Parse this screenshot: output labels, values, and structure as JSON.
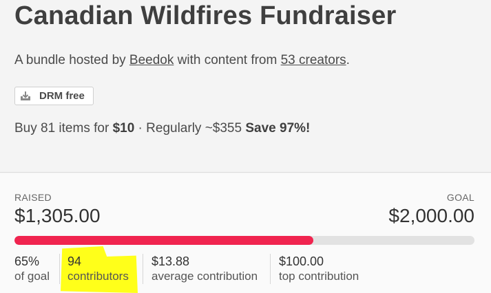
{
  "header": {
    "title": "Canadian Wildfires Fundraiser",
    "byline_prefix": "A bundle hosted by",
    "host_name": "Beedok",
    "byline_mid": "with content from",
    "creators_link": "53 creators",
    "byline_suffix": "."
  },
  "badge": {
    "label": "DRM free",
    "icon": "download-tray-icon"
  },
  "pricing": {
    "prefix": "Buy 81 items for",
    "price": "$10",
    "middle": "· Regularly ~$355",
    "savings": "Save 97%!"
  },
  "funding": {
    "raised_label": "RAISED",
    "raised_value": "$1,305.00",
    "goal_label": "GOAL",
    "goal_value": "$2,000.00",
    "progress_fraction": 0.65,
    "bar_color": "#f0244f"
  },
  "stats": [
    {
      "value": "65%",
      "caption": "of goal"
    },
    {
      "value": "94",
      "caption": "contributors"
    },
    {
      "value": "$13.88",
      "caption": "average contribution"
    },
    {
      "value": "$100.00",
      "caption": "top contribution"
    }
  ],
  "highlight_color": "#ffff1a"
}
